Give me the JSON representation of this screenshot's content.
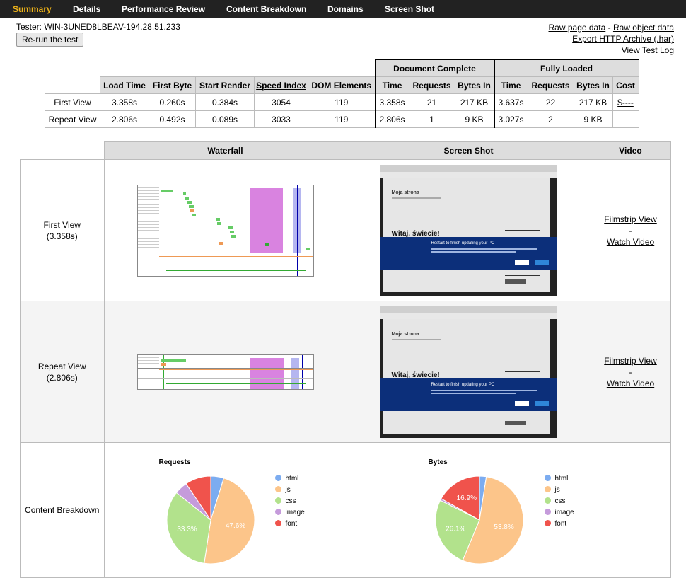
{
  "nav": {
    "tabs": [
      {
        "label": "Summary"
      },
      {
        "label": "Details"
      },
      {
        "label": "Performance Review"
      },
      {
        "label": "Content Breakdown"
      },
      {
        "label": "Domains"
      },
      {
        "label": "Screen Shot"
      }
    ]
  },
  "header": {
    "tester": "Tester: WIN-3UNED8LBEAV-194.28.51.233",
    "rerun_label": "Re-run the test",
    "raw_page_data": "Raw page data",
    "link_sep": "-",
    "raw_object_data": "Raw object data",
    "export_har": "Export HTTP Archive (.har)",
    "view_test_log": "View Test Log"
  },
  "results": {
    "group_headers": {
      "document_complete": "Document Complete",
      "fully_loaded": "Fully Loaded"
    },
    "columns": [
      "Load Time",
      "First Byte",
      "Start Render",
      "Speed Index",
      "DOM Elements",
      "Time",
      "Requests",
      "Bytes In",
      "Time",
      "Requests",
      "Bytes In",
      "Cost"
    ],
    "rows": [
      {
        "label": "First View",
        "cells": [
          "3.358s",
          "0.260s",
          "0.384s",
          "3054",
          "119",
          "3.358s",
          "21",
          "217 KB",
          "3.637s",
          "22",
          "217 KB",
          "$----"
        ]
      },
      {
        "label": "Repeat View",
        "cells": [
          "2.806s",
          "0.492s",
          "0.089s",
          "3033",
          "119",
          "2.806s",
          "1",
          "9 KB",
          "3.027s",
          "2",
          "9 KB",
          ""
        ]
      }
    ]
  },
  "grid": {
    "headers": {
      "waterfall": "Waterfall",
      "screenshot": "Screen Shot",
      "video": "Video"
    },
    "first_view": {
      "label": "First View",
      "time": "(3.358s)"
    },
    "repeat_view": {
      "label": "Repeat View",
      "time": "(2.806s)"
    },
    "filmstrip_label": "Filmstrip View",
    "dash": "-",
    "watch_video_label": "Watch Video",
    "content_breakdown_label": "Content Breakdown"
  },
  "screenshot": {
    "site_title": "Moja strona",
    "welcome": "Witaj, świecie!",
    "dialog_title": "Restart to finish updating your PC"
  },
  "colors": {
    "html": "#7cacf0",
    "js": "#fcc58a",
    "css": "#b2e28c",
    "image": "#c59bdb",
    "font": "#f0534c"
  },
  "chart_data": [
    {
      "type": "pie",
      "title": "Requests",
      "categories": [
        "html",
        "js",
        "css",
        "image",
        "font"
      ],
      "values": [
        4.8,
        47.6,
        33.3,
        4.8,
        9.5
      ],
      "data_labels": [
        "",
        "47.6%",
        "33.3%",
        "",
        ""
      ]
    },
    {
      "type": "pie",
      "title": "Bytes",
      "categories": [
        "html",
        "js",
        "css",
        "image",
        "font"
      ],
      "values": [
        2.5,
        53.8,
        26.1,
        0.7,
        16.9
      ],
      "data_labels": [
        "",
        "53.8%",
        "26.1%",
        "",
        "16.9%"
      ]
    }
  ]
}
